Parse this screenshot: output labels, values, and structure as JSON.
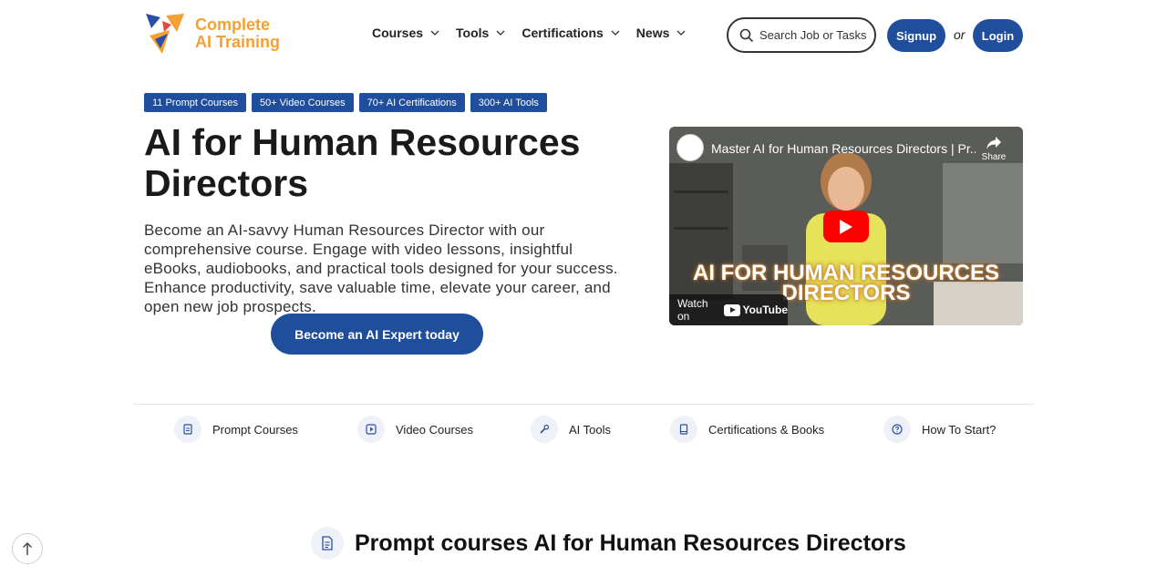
{
  "brand": {
    "line1": "Complete",
    "line2": "AI Training"
  },
  "nav": [
    {
      "label": "Courses"
    },
    {
      "label": "Tools"
    },
    {
      "label": "Certifications"
    },
    {
      "label": "News"
    }
  ],
  "search": {
    "placeholder": "Search Job or Tasks"
  },
  "auth": {
    "signup": "Signup",
    "or": "or",
    "login": "Login"
  },
  "badges": [
    "11 Prompt Courses",
    "50+ Video Courses",
    "70+ AI Certifications",
    "300+ AI Tools"
  ],
  "hero": {
    "title": "AI for Human Resources Directors",
    "description": "Become an AI-savvy Human Resources Director with our comprehensive course. Engage with video lessons, insightful eBooks, audiobooks, and practical tools designed for your success. Enhance productivity, save valuable time, elevate your career, and open new job prospects.",
    "cta": "Become an AI Expert today"
  },
  "video": {
    "title": "Master AI for Human Resources Directors | Pr...",
    "share": "Share",
    "overlay_line1": "AI FOR HUMAN RESOURCES",
    "overlay_line2": "DIRECTORS",
    "watch_on": "Watch on",
    "youtube": "YouTube"
  },
  "quick_links": [
    {
      "label": "Prompt Courses",
      "icon": "document-icon"
    },
    {
      "label": "Video Courses",
      "icon": "play-icon"
    },
    {
      "label": "AI Tools",
      "icon": "wrench-icon"
    },
    {
      "label": "Certifications & Books",
      "icon": "book-icon"
    },
    {
      "label": "How To Start?",
      "icon": "question-icon"
    }
  ],
  "section": {
    "title": "Prompt courses AI for Human Resources Directors",
    "icon": "document-icon"
  },
  "colors": {
    "primary": "#1f4e9c",
    "brand_orange": "#f5a033",
    "youtube_red": "#ff0000"
  }
}
